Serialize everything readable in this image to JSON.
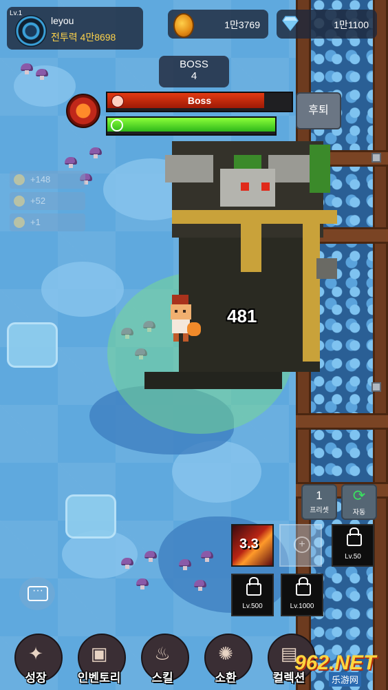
{
  "profile": {
    "level": "Lv.1",
    "name": "leyou",
    "power": "전투력 4만8698"
  },
  "resources": {
    "coins": "1만3769",
    "gems": "1만1100"
  },
  "stage": {
    "title": "BOSS",
    "number": "4"
  },
  "boss": {
    "label": "Boss",
    "hp_fraction": 0.85,
    "time_fraction": 1.0
  },
  "retreat_label": "후퇴",
  "buffs": [
    "+148",
    "+52",
    "+1"
  ],
  "damage_text": "481",
  "preset": {
    "number": "1",
    "label": "프리셋"
  },
  "auto": {
    "label": "자동"
  },
  "skills": {
    "active_count": "3.3",
    "lock_lv50": "Lv.50",
    "lock_lv500": "Lv.500",
    "lock_lv1000": "Lv.1000"
  },
  "nav": [
    "성장",
    "인벤토리",
    "스킬",
    "소환",
    "컬렉션"
  ],
  "watermark": {
    "main": "962.NET",
    "sub": "乐游网"
  },
  "colors": {
    "boss_hp": "#e23a12",
    "timer": "#5fe02a",
    "coin": "#f2a024",
    "wall": "#2a5f95"
  }
}
